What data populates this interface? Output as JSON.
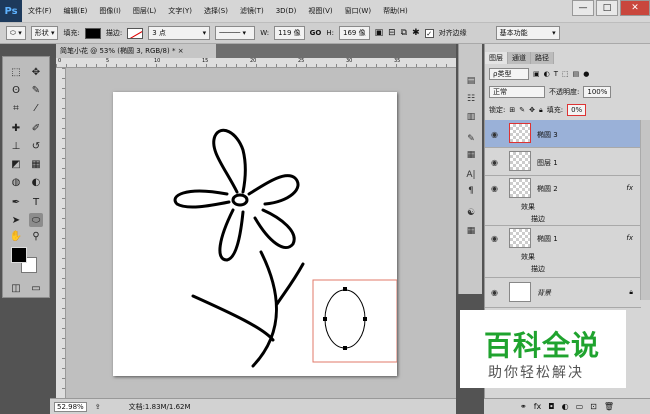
{
  "app": {
    "logo": "Ps"
  },
  "menu": [
    "文件(F)",
    "编辑(E)",
    "图像(I)",
    "图层(L)",
    "文字(Y)",
    "选择(S)",
    "滤镜(T)",
    "3D(D)",
    "视图(V)",
    "窗口(W)",
    "帮助(H)"
  ],
  "window_controls": {
    "minimize": "—",
    "maximize": "□",
    "close": "✕"
  },
  "options": {
    "mode": "形状",
    "fill_label": "填充:",
    "stroke_label": "描边:",
    "stroke_width": "3 点",
    "w_label": "W:",
    "w_value": "119 像",
    "link": "GO",
    "h_label": "H:",
    "h_value": "169 像",
    "align_edges": "对齐边缘",
    "align_checked": "✓",
    "workspace": "基本功能"
  },
  "document": {
    "tab_title": "简笔小花 @ 53% (椭圆 3, RGB/8) *",
    "tab_close": "×"
  },
  "ruler_top_labels": [
    "0",
    "5",
    "10",
    "15",
    "20",
    "25",
    "30",
    "35"
  ],
  "status": {
    "zoom": "52.98%",
    "doc_info": "文档:1.83M/1.62M"
  },
  "layers_panel": {
    "tabs": [
      "图层",
      "通道",
      "路径"
    ],
    "kind_filter": "ρ类型",
    "blend_mode": "正常",
    "opacity_label": "不透明度:",
    "opacity_value": "100%",
    "lock_label": "锁定:",
    "fill_label": "填充:",
    "fill_value": "0%",
    "layers": [
      {
        "name": "椭圆 3",
        "selected": true,
        "fx": ""
      },
      {
        "name": "图层 1",
        "selected": false,
        "fx": ""
      },
      {
        "name": "椭圆 2",
        "selected": false,
        "fx": "fx",
        "effects_label": "效果",
        "effect": "描边"
      },
      {
        "name": "椭圆 1",
        "selected": false,
        "fx": "fx",
        "effects_label": "效果",
        "effect": "描边"
      },
      {
        "name": "背景",
        "selected": false,
        "fx": ""
      }
    ]
  },
  "watermark": {
    "title": "百科全说",
    "subtitle": "助你轻松解决"
  },
  "colors": {
    "accent_selection": "#9ab1d8",
    "watermark_green": "#1fa32e",
    "selection_box": "#e07a6a"
  }
}
